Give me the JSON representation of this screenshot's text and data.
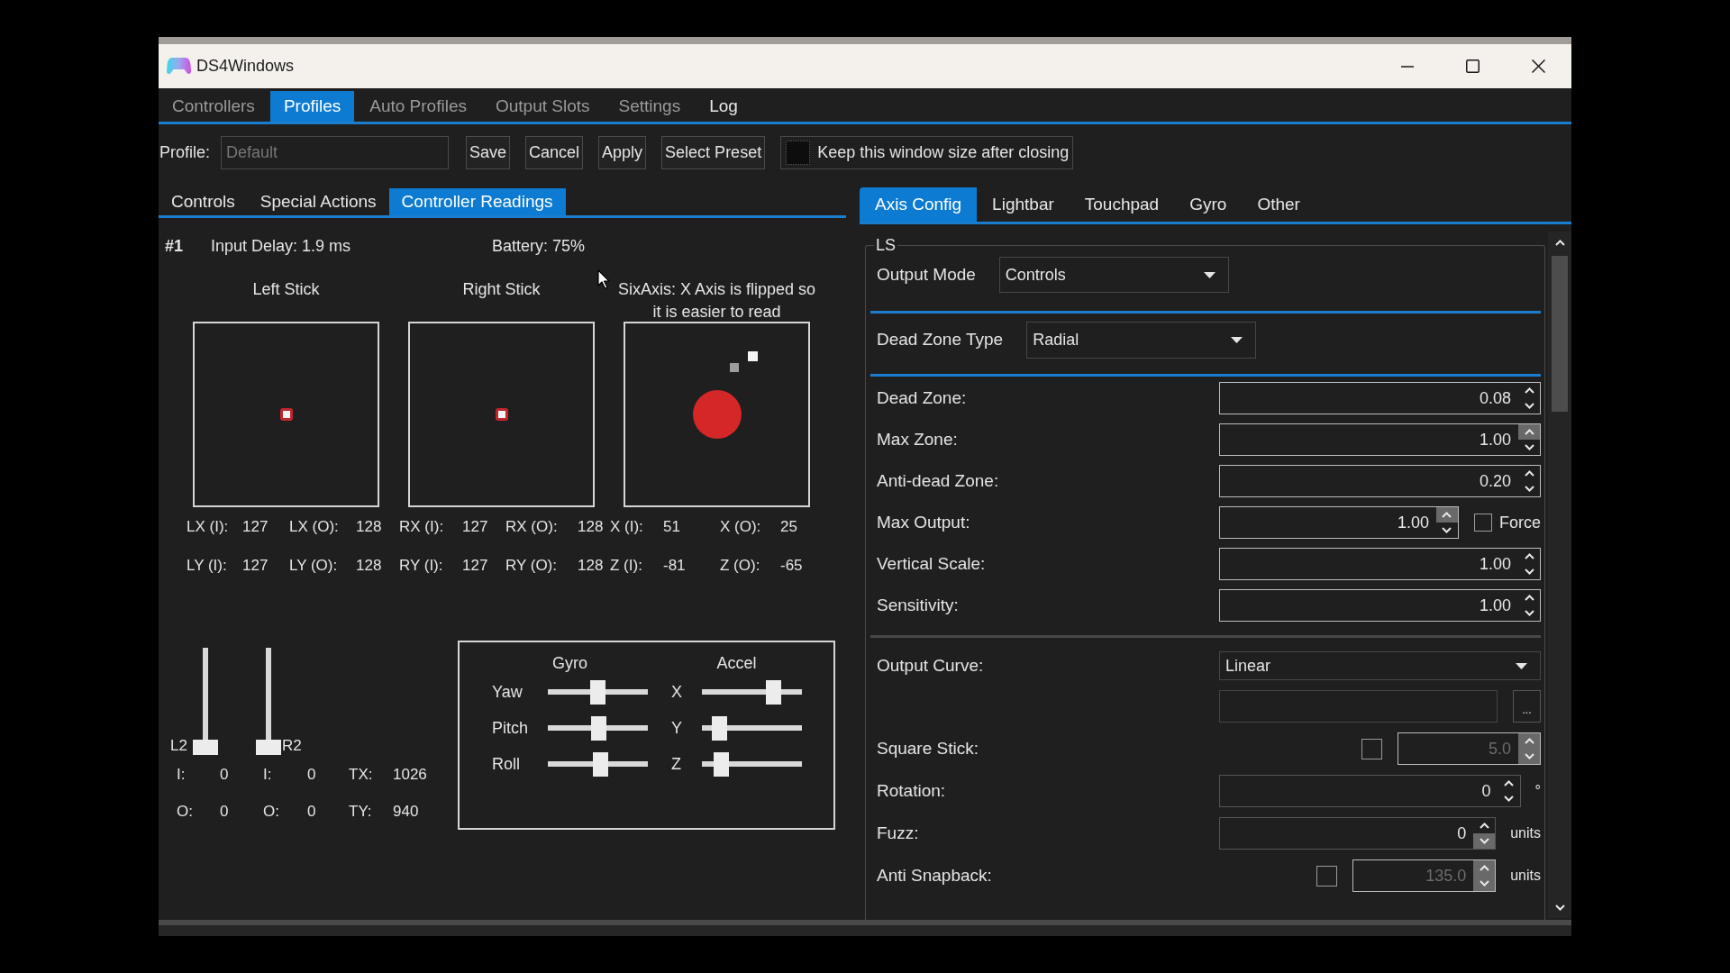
{
  "window": {
    "title": "DS4Windows"
  },
  "main_tabs": [
    {
      "label": "Controllers",
      "selected": false,
      "disabled": true
    },
    {
      "label": "Profiles",
      "selected": true,
      "disabled": false
    },
    {
      "label": "Auto Profiles",
      "selected": false,
      "disabled": true
    },
    {
      "label": "Output Slots",
      "selected": false,
      "disabled": true
    },
    {
      "label": "Settings",
      "selected": false,
      "disabled": true
    },
    {
      "label": "Log",
      "selected": false,
      "disabled": false
    }
  ],
  "profile_bar": {
    "label": "Profile:",
    "name_field": {
      "value": "Default",
      "disabled": true
    },
    "buttons": [
      "Save",
      "Cancel",
      "Apply",
      "Select Preset"
    ],
    "keep_size": {
      "label": "Keep this window size after closing",
      "checked": false
    }
  },
  "left_tabs": [
    {
      "label": "Controls",
      "selected": false
    },
    {
      "label": "Special Actions",
      "selected": false
    },
    {
      "label": "Controller Readings",
      "selected": true
    }
  ],
  "readings_panel": {
    "controller": "#1",
    "input_delay": "Input Delay: 1.9 ms",
    "battery": "Battery: 75%",
    "sticks": [
      {
        "kind": "stick",
        "title": "Left Stick"
      },
      {
        "kind": "stick",
        "title": "Right Stick"
      },
      {
        "kind": "sixaxis",
        "title": "SixAxis: X Axis is flipped so it is easier to read"
      }
    ],
    "readings": [
      [
        {
          "label": "LX (I):",
          "value": "127"
        },
        {
          "label": "LX (O):",
          "value": "128"
        },
        {
          "label": "RX (I):",
          "value": "127"
        },
        {
          "label": "RX (O):",
          "value": "128"
        },
        {
          "label": "X (I):",
          "value": "51"
        },
        {
          "label": "X (O):",
          "value": "25"
        }
      ],
      [
        {
          "label": "LY (I):",
          "value": "127"
        },
        {
          "label": "LY (O):",
          "value": "128"
        },
        {
          "label": "RY (I):",
          "value": "127"
        },
        {
          "label": "RY (O):",
          "value": "128"
        },
        {
          "label": "Z (I):",
          "value": "-81"
        },
        {
          "label": "Z (O):",
          "value": "-65"
        }
      ]
    ],
    "triggers": [
      {
        "label": "L2",
        "level": 0,
        "rows": [
          {
            "label": "I:",
            "value": "0"
          },
          {
            "label": "O:",
            "value": "0"
          }
        ]
      },
      {
        "label": "R2",
        "level": 0,
        "rows": [
          {
            "label": "I:",
            "value": "0"
          },
          {
            "label": "O:",
            "value": "0"
          }
        ]
      }
    ],
    "touch": [
      {
        "label": "TX:",
        "value": "1026"
      },
      {
        "label": "TY:",
        "value": "940"
      }
    ],
    "motion": [
      {
        "title": "Gyro",
        "axes": [
          {
            "label": "Yaw",
            "level": 0.5
          },
          {
            "label": "Pitch",
            "level": 0.51
          },
          {
            "label": "Roll",
            "level": 0.53
          }
        ]
      },
      {
        "title": "Accel",
        "axes": [
          {
            "label": "X",
            "level": 0.75
          },
          {
            "label": "Y",
            "level": 0.12
          },
          {
            "label": "Z",
            "level": 0.14
          }
        ]
      }
    ]
  },
  "right_tabs": [
    {
      "label": "Axis Config",
      "selected": true
    },
    {
      "label": "Lightbar",
      "selected": false
    },
    {
      "label": "Touchpad",
      "selected": false
    },
    {
      "label": "Gyro",
      "selected": false
    },
    {
      "label": "Other",
      "selected": false
    }
  ],
  "ls_group": {
    "title": "LS",
    "output_mode": {
      "label": "Output Mode",
      "value": "Controls"
    },
    "dead_zone_type": {
      "label": "Dead Zone Type",
      "value": "Radial"
    },
    "zone_settings": [
      {
        "kind": "spinner",
        "label": "Dead Zone:",
        "value": "0.08",
        "up_disabled": false,
        "down_disabled": false
      },
      {
        "kind": "spinner",
        "label": "Max Zone:",
        "value": "1.00",
        "up_disabled": true,
        "down_disabled": false
      },
      {
        "kind": "spinner",
        "label": "Anti-dead Zone:",
        "value": "0.20",
        "up_disabled": false,
        "down_disabled": false
      },
      {
        "kind": "spinner",
        "label": "Max Output:",
        "value": "1.00",
        "up_disabled": true,
        "down_disabled": false,
        "option": {
          "label": "Force",
          "checked": false
        }
      },
      {
        "kind": "spinner",
        "label": "Vertical Scale:",
        "value": "1.00",
        "up_disabled": false,
        "down_disabled": false
      },
      {
        "kind": "spinner",
        "label": "Sensitivity:",
        "value": "1.00",
        "up_disabled": false,
        "down_disabled": false
      }
    ],
    "curve_settings": [
      {
        "kind": "dropdown",
        "label": "Output Curve:",
        "value": "Linear"
      },
      {
        "kind": "editor",
        "button": "..."
      },
      {
        "kind": "togglespinner",
        "label": "Square Stick:",
        "checked": false,
        "value": "5.0",
        "disabled": true
      },
      {
        "kind": "stepper",
        "label": "Rotation:",
        "value": "0",
        "unit": "°",
        "up_disabled": false,
        "down_disabled": false
      },
      {
        "kind": "stepper",
        "label": "Fuzz:",
        "value": "0",
        "unit": "units",
        "up_disabled": false,
        "down_disabled": true
      },
      {
        "kind": "togglespinner",
        "label": "Anti Snapback:",
        "checked": false,
        "value": "135.0",
        "disabled": true,
        "unit": "units"
      }
    ]
  }
}
